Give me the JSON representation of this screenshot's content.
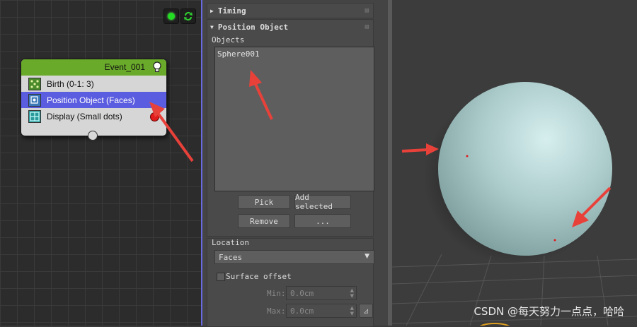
{
  "particle_view": {
    "event": {
      "title": "Event_001",
      "operators": [
        {
          "label": "Birth (0-1: 3)"
        },
        {
          "label": "Position Object (Faces)"
        },
        {
          "label": "Display (Small dots)"
        }
      ]
    }
  },
  "panel": {
    "timing": {
      "title": "Timing"
    },
    "position_object": {
      "title": "Position Object",
      "objects_label": "Objects",
      "objects": [
        "Sphere001"
      ],
      "pick_label": "Pick",
      "add_selected_label": "Add selected",
      "remove_label": "Remove",
      "more_label": "...",
      "location_label": "Location",
      "location_value": "Faces",
      "surface_offset_label": "Surface offset",
      "min_label": "Min:",
      "min_value": "0.0cm",
      "max_label": "Max:",
      "max_value": "0.0cm"
    }
  },
  "watermark": "CSDN @每天努力一点点，哈哈",
  "colors": {
    "event_header": "#6aaa2a",
    "selected_row": "#5b5de0",
    "sphere": "#a9c9c9",
    "arrow": "#e8413a"
  },
  "icons": [
    "play-green-icon",
    "refresh-icon",
    "lightbulb-icon",
    "birth-icon",
    "position-object-icon",
    "display-icon"
  ]
}
